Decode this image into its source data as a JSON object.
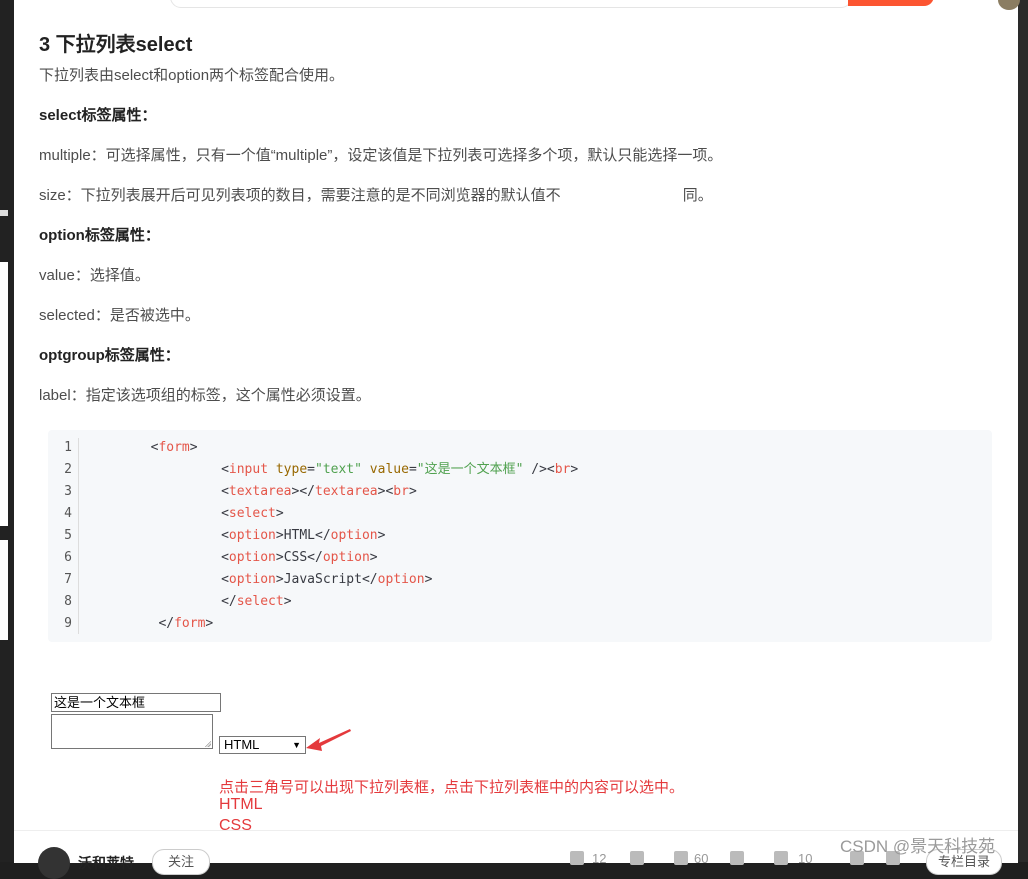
{
  "article": {
    "heading": "3 下拉列表select",
    "intro": "下拉列表由select和option两个标签配合使用。",
    "select_attrs_title": "select标签属性：",
    "multiple_desc": "multiple：可选择属性，只有一个值“multiple”，设定该值是下拉列表可选择多个项，默认只能选择一项。",
    "size_desc_a": "size：下拉列表展开后可见列表项的数目，需要注意的是不同浏览器的默认值不",
    "size_desc_b": "同。",
    "option_attrs_title": "option标签属性：",
    "value_desc": "value：选择值。",
    "selected_desc": "selected：是否被选中。",
    "optgroup_attrs_title": "optgroup标签属性：",
    "label_desc": "label：指定该选项组的标签，这个属性必须设置。"
  },
  "code": {
    "line_numbers": [
      "1",
      "2",
      "3",
      "4",
      "5",
      "6",
      "7",
      "8",
      "9"
    ],
    "tokens": {
      "form": "form",
      "input": "input",
      "type_attr": "type",
      "type_val": "\"text\"",
      "value_attr": "value",
      "value_val": "\"这是一个文本框\"",
      "br": "br",
      "textarea": "textarea",
      "select": "select",
      "option": "option",
      "html": "HTML",
      "css": "CSS",
      "js": "JavaScript"
    }
  },
  "demo": {
    "text_input_value": "这是一个文本框",
    "select_value": "HTML",
    "note": "点击三角号可以出现下拉列表框，点击下拉列表框中的内容可以选中。",
    "options": [
      "HTML",
      "CSS"
    ]
  },
  "bottom_bar": {
    "author": "沃和莱特",
    "follow": "关注",
    "likes": "12",
    "favorites": "60",
    "comments": "10",
    "catalog": "专栏目录"
  },
  "watermark": "CSDN @景天科技苑",
  "colors": {
    "accent": "#fc5531",
    "note_red": "#e4393c",
    "code_bg": "#f6f8fa"
  }
}
